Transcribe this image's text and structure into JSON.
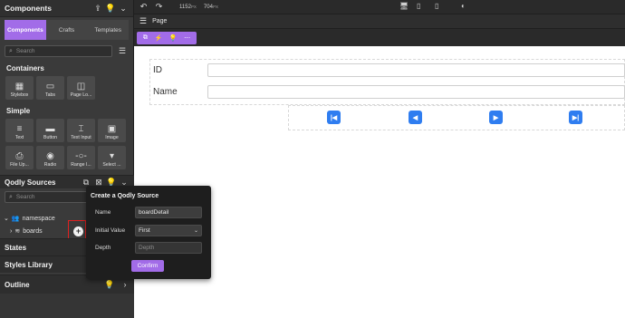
{
  "components_panel": {
    "title": "Components",
    "tabs": [
      "Components",
      "Crafts",
      "Templates"
    ],
    "search_placeholder": "Search",
    "containers_title": "Containers",
    "containers": [
      {
        "label": "Stylebox",
        "icon": "stylebox-icon"
      },
      {
        "label": "Tabs",
        "icon": "tabs-icon"
      },
      {
        "label": "Page Lo...",
        "icon": "page-layout-icon"
      }
    ],
    "simple_title": "Simple",
    "simple_row1": [
      {
        "label": "Text",
        "icon": "text-icon"
      },
      {
        "label": "Button",
        "icon": "button-icon"
      },
      {
        "label": "Text Input",
        "icon": "text-input-icon"
      },
      {
        "label": "Image",
        "icon": "image-icon"
      }
    ],
    "simple_row2": [
      {
        "label": "File Up...",
        "icon": "file-upload-icon"
      },
      {
        "label": "Radio",
        "icon": "radio-icon"
      },
      {
        "label": "Range I...",
        "icon": "range-input-icon"
      },
      {
        "label": "Select ...",
        "icon": "select-icon"
      }
    ]
  },
  "qodly_sources": {
    "title": "Qodly Sources",
    "search_placeholder": "Search",
    "namespace_label": "namespace",
    "boards_label": "boards"
  },
  "sections": {
    "states": "States",
    "styles_library": "Styles Library",
    "outline": "Outline"
  },
  "topbar": {
    "width_value": "1152",
    "width_unit": "PX",
    "height_value": "704",
    "height_unit": "PX"
  },
  "breadcrumb": {
    "page_label": "Page"
  },
  "canvas": {
    "id_label": "ID",
    "name_label": "Name"
  },
  "popup": {
    "title": "Create a Qodly Source",
    "name_label": "Name",
    "name_value": "boardDetail",
    "initial_value_label": "Initial Value",
    "initial_value_selected": "First",
    "depth_label": "Depth",
    "depth_placeholder": "Depth",
    "confirm_label": "Confirm"
  },
  "colors": {
    "accent": "#a26ce8",
    "nav_button": "#2f7df0",
    "highlight_box": "#e02020"
  }
}
